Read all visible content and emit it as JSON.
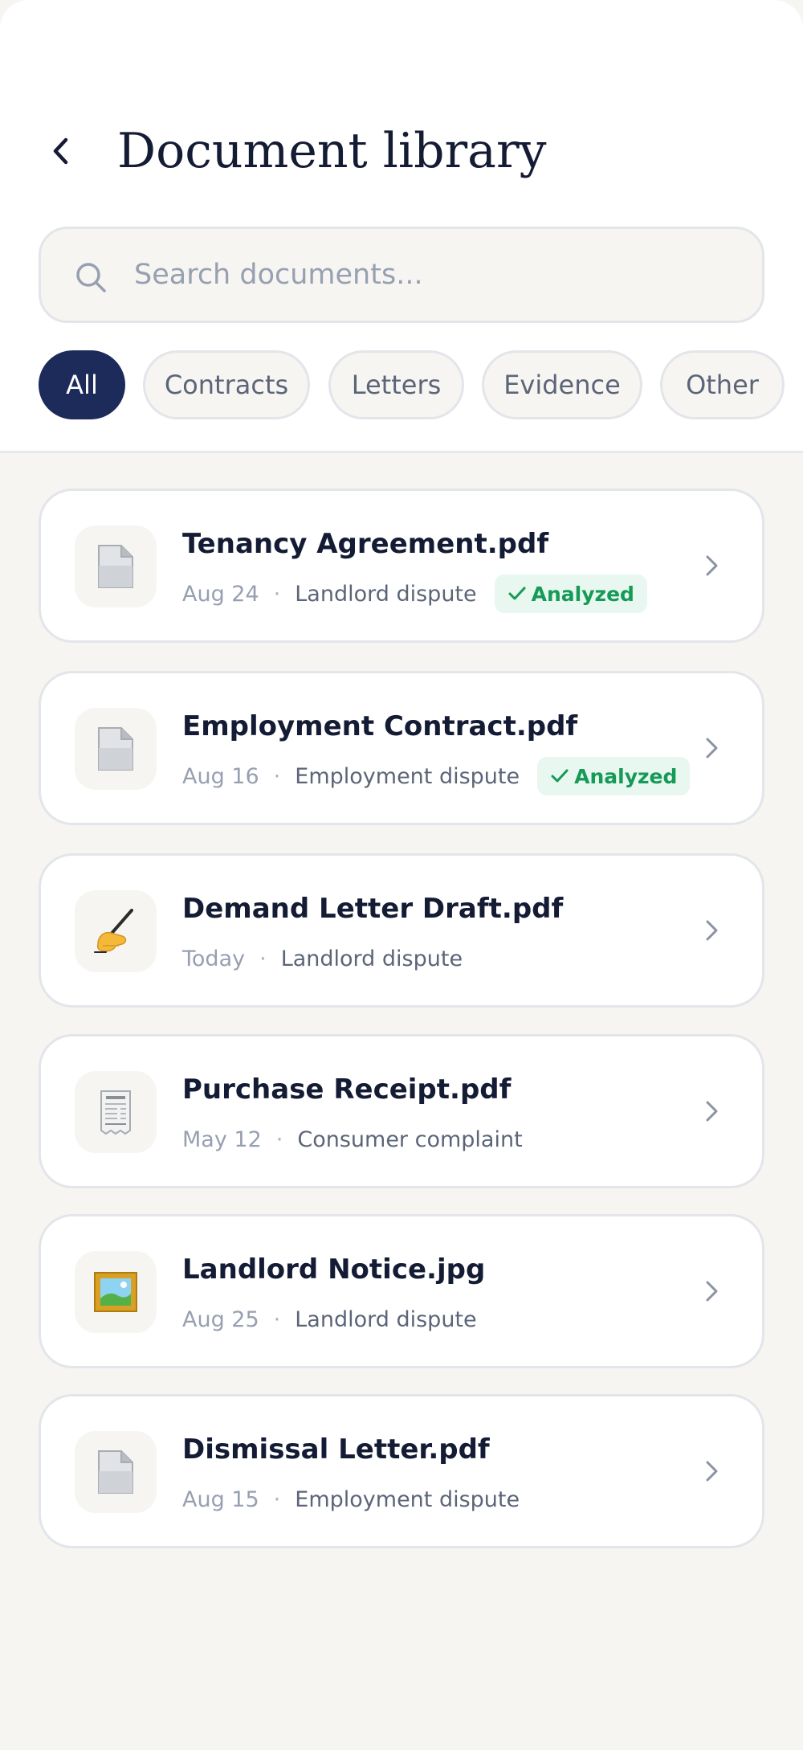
{
  "header": {
    "title": "Document library",
    "back_icon": "chevron-left-icon"
  },
  "search": {
    "placeholder": "Search documents...",
    "value": "",
    "icon": "search-icon"
  },
  "filters": [
    {
      "label": "All",
      "active": true
    },
    {
      "label": "Contracts",
      "active": false
    },
    {
      "label": "Letters",
      "active": false
    },
    {
      "label": "Evidence",
      "active": false
    },
    {
      "label": "Other",
      "active": false
    }
  ],
  "documents": [
    {
      "name": "Tenancy Agreement.pdf",
      "date": "Aug 24",
      "separator": "·",
      "category": "Landlord dispute",
      "badge": "Analyzed",
      "icon": "page-facing-up-icon"
    },
    {
      "name": "Employment Contract.pdf",
      "date": "Aug 16",
      "separator": "·",
      "category": "Employment dispute",
      "badge": "Analyzed",
      "icon": "page-facing-up-icon"
    },
    {
      "name": "Demand Letter Draft.pdf",
      "date": "Today",
      "separator": "·",
      "category": "Landlord dispute",
      "badge": "",
      "icon": "writing-hand-icon"
    },
    {
      "name": "Purchase Receipt.pdf",
      "date": "May 12",
      "separator": "·",
      "category": "Consumer complaint",
      "badge": "",
      "icon": "receipt-icon"
    },
    {
      "name": "Landlord Notice.jpg",
      "date": "Aug 25",
      "separator": "·",
      "category": "Landlord dispute",
      "badge": "",
      "icon": "framed-picture-icon"
    },
    {
      "name": "Dismissal Letter.pdf",
      "date": "Aug 15",
      "separator": "·",
      "category": "Employment dispute",
      "badge": "",
      "icon": "page-facing-up-icon"
    }
  ],
  "colors": {
    "primary": "#1c2b5a",
    "background": "#f6f5f2",
    "success": "#159a57",
    "success_bg": "#e8f7ef",
    "text": "#141b34",
    "muted": "#97a0b1"
  }
}
